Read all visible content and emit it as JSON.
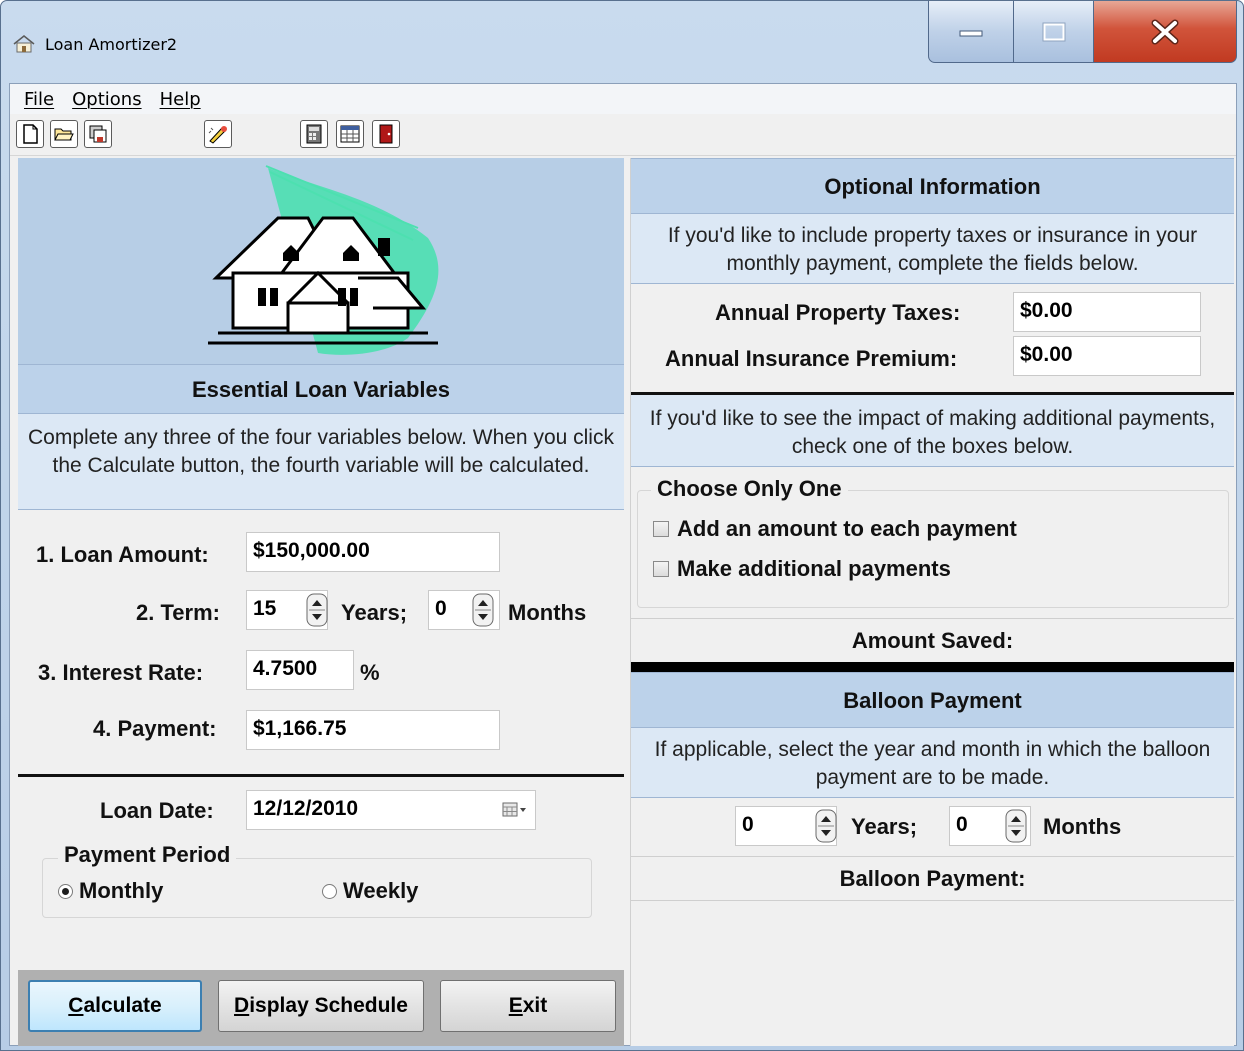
{
  "window": {
    "title": "Loan Amortizer2"
  },
  "menu": [
    "File",
    "Options",
    "Help"
  ],
  "toolbar": [
    "new-icon",
    "open-icon",
    "save-icon",
    "edit-icon",
    "calculator-icon",
    "schedule-icon",
    "exit-icon"
  ],
  "essential": {
    "header": "Essential Loan Variables",
    "description": "Complete any three of the four variables below. When you click the Calculate button, the fourth variable will be calculated.",
    "loan_amount_label": "1. Loan Amount:",
    "loan_amount": "$150,000.00",
    "term_label": "2. Term:",
    "term_years": "15",
    "years_label": "Years;",
    "term_months": "0",
    "months_label": "Months",
    "interest_label": "3. Interest Rate:",
    "interest_rate": "4.7500",
    "percent": "%",
    "payment_label": "4. Payment:",
    "payment": "$1,166.75",
    "loan_date_label": "Loan Date:",
    "loan_date": "12/12/2010",
    "payment_period_title": "Payment Period",
    "monthly": "Monthly",
    "weekly": "Weekly"
  },
  "buttons": {
    "calculate": "Calculate",
    "display_schedule": "Display Schedule",
    "exit": "Exit"
  },
  "optional": {
    "header": "Optional Information",
    "description": "If you'd like to include property taxes or insurance in your monthly payment, complete the fields below.",
    "taxes_label": "Annual Property Taxes:",
    "taxes": "$0.00",
    "insurance_label": "Annual Insurance Premium:",
    "insurance": "$0.00",
    "additional_description": "If you'd like to see the impact of making additional payments, check one of the boxes below.",
    "choose_title": "Choose Only One",
    "add_amount": "Add an amount to each payment",
    "make_additional": "Make additional payments",
    "amount_saved": "Amount Saved:"
  },
  "balloon": {
    "header": "Balloon Payment",
    "description": "If applicable, select the year and month in which the balloon payment are to be made.",
    "years": "0",
    "years_label": "Years;",
    "months": "0",
    "months_label": "Months",
    "result_label": "Balloon Payment:"
  }
}
